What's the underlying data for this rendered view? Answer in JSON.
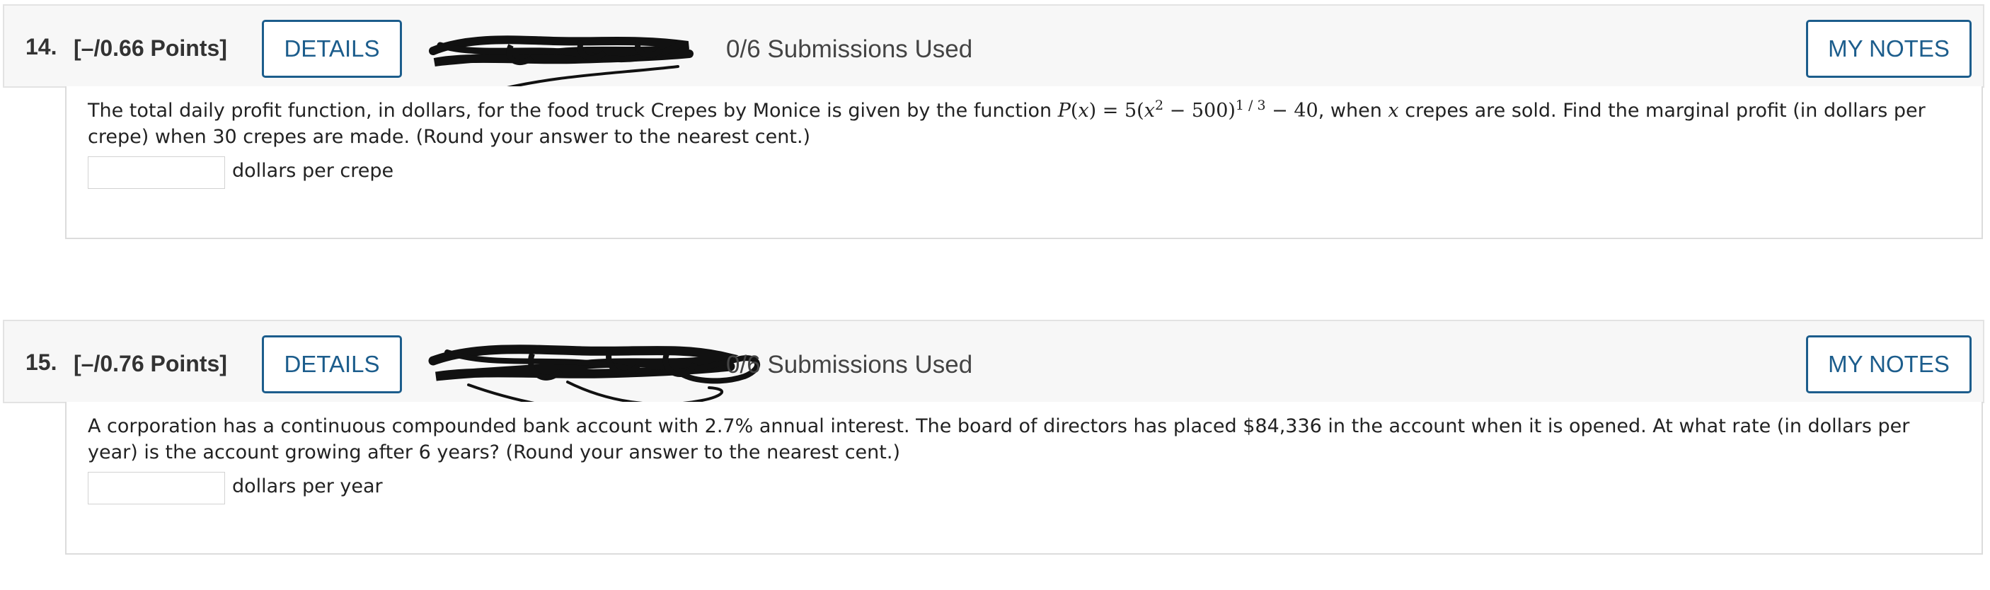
{
  "questions": [
    {
      "number": "14.",
      "points": "[–/0.66 Points]",
      "details_label": "DETAILS",
      "submissions": "0/6 Submissions Used",
      "notes_label": "MY NOTES",
      "text_before": "The total daily profit function, in dollars, for the food truck Crepes by Monice is given by the function ",
      "formula": {
        "func": "P",
        "arg": "x",
        "eq": " = 5(",
        "base_var": "x",
        "base_exp": "2",
        "base_rest": " − 500)",
        "outer_exp": "1 / 3",
        "tail": " − 40"
      },
      "text_middle": ", when ",
      "text_var": "x",
      "text_after": " crepes are sold. Find the marginal profit (in dollars per crepe) when 30 crepes are made. (Round your answer to the nearest cent.)",
      "answer_value": "",
      "answer_unit": "dollars per crepe"
    },
    {
      "number": "15.",
      "points": "[–/0.76 Points]",
      "details_label": "DETAILS",
      "submissions": "0/6 Submissions Used",
      "notes_label": "MY NOTES",
      "text": "A corporation has a continuous compounded bank account with 2.7% annual interest. The board of directors has placed $84,336 in the account when it is opened. At what rate (in dollars per year) is the account growing after 6 years? (Round your answer to the nearest cent.)",
      "answer_value": "",
      "answer_unit": "dollars per year"
    }
  ]
}
